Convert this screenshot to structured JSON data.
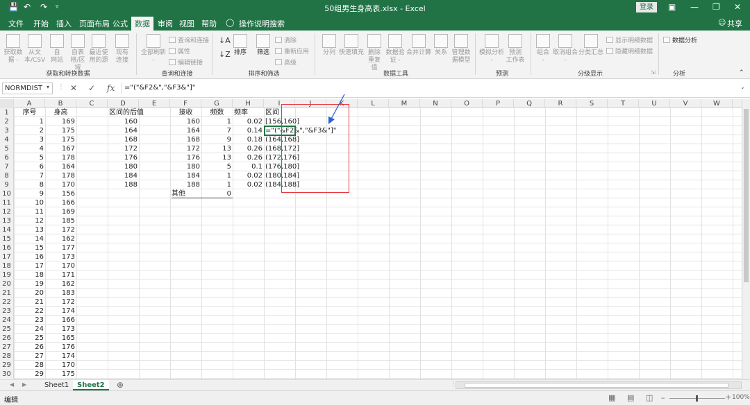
{
  "window": {
    "title": "50组男生身高表.xlsx - Excel",
    "login_label": "登录"
  },
  "menu": {
    "tabs": [
      "文件",
      "开始",
      "插入",
      "页面布局",
      "公式",
      "数据",
      "审阅",
      "视图",
      "帮助"
    ],
    "active_tab": "数据",
    "tell_me": "操作说明搜索",
    "share": "共享"
  },
  "ribbon": {
    "groups": [
      "获取和转换数据",
      "查询和连接",
      "排序和筛选",
      "数据工具",
      "预测",
      "分级显示",
      "分析"
    ],
    "get_data": {
      "btn1_l1": "获取数",
      "btn1_l2": "据 -",
      "btn2_l1": "从文",
      "btn2_l2": "本/CSV",
      "btn3_l1": "自",
      "btn3_l2": "网站",
      "btn4_l1": "自表",
      "btn4_l2": "格/区域",
      "btn5_l1": "最近使",
      "btn5_l2": "用的源",
      "btn6_l1": "现有",
      "btn6_l2": "连接"
    },
    "queries": {
      "refresh_l1": "全部刷新",
      "refresh_l2": "-",
      "q1": "查询和连接",
      "q2": "属性",
      "q3": "编辑链接"
    },
    "sort": {
      "sort": "排序",
      "filter": "筛选",
      "clear": "清除",
      "reapply": "重新应用",
      "advanced": "高级"
    },
    "tools": {
      "split": "分列",
      "flash": "快速填充",
      "dup_l1": "删除",
      "dup_l2": "重复值",
      "valid_l1": "数据验",
      "valid_l2": "证 -",
      "consol": "合并计算",
      "rel": "关系",
      "model_l1": "管理数",
      "model_l2": "据模型"
    },
    "forecast": {
      "whatif_l1": "模拟分析",
      "whatif_l2": "-",
      "sheet_l1": "预测",
      "sheet_l2": "工作表"
    },
    "outline": {
      "group_l1": "组合",
      "group_l2": "-",
      "ungroup_l1": "取消组合",
      "ungroup_l2": "-",
      "subtotal": "分类汇总",
      "show": "显示明细数据",
      "hide": "隐藏明细数据"
    },
    "analysis": {
      "data_analysis": "数据分析"
    }
  },
  "formula_bar": {
    "name_box": "NORMDIST",
    "formula": "=\"(\"&F2&\",\"&F3&\"]\""
  },
  "columns": [
    "A",
    "B",
    "C",
    "D",
    "E",
    "F",
    "G",
    "H",
    "I",
    "J",
    "K",
    "L",
    "M",
    "N",
    "O",
    "P",
    "Q",
    "R",
    "S",
    "T",
    "U",
    "V",
    "W"
  ],
  "rows": [
    "1",
    "2",
    "3",
    "4",
    "5",
    "6",
    "7",
    "8",
    "9",
    "10",
    "11",
    "12",
    "13",
    "14",
    "15",
    "16",
    "17",
    "18",
    "19",
    "20",
    "21",
    "22",
    "23",
    "24",
    "25",
    "26",
    "27",
    "28",
    "29",
    "30"
  ],
  "sheet": {
    "A1": "序号",
    "B1": "身高",
    "D1": "区间的后值",
    "F1": "接收",
    "G1": "频数",
    "H1": "频率",
    "I1": "区间",
    "A": [
      "1",
      "2",
      "3",
      "4",
      "5",
      "6",
      "7",
      "8",
      "9",
      "10",
      "11",
      "12",
      "13",
      "14",
      "15",
      "16",
      "17",
      "18",
      "19",
      "20",
      "21",
      "22",
      "23",
      "24",
      "25",
      "26",
      "27",
      "28",
      "29"
    ],
    "B": [
      "169",
      "175",
      "175",
      "167",
      "178",
      "164",
      "178",
      "170",
      "156",
      "166",
      "169",
      "185",
      "172",
      "162",
      "177",
      "173",
      "170",
      "171",
      "162",
      "183",
      "172",
      "174",
      "166",
      "173",
      "165",
      "176",
      "174",
      "170",
      "175"
    ],
    "D": [
      "160",
      "164",
      "168",
      "172",
      "176",
      "180",
      "184",
      "188"
    ],
    "F": [
      "160",
      "164",
      "168",
      "172",
      "176",
      "180",
      "184",
      "188"
    ],
    "G": [
      "1",
      "7",
      "9",
      "13",
      "13",
      "5",
      "1",
      "1"
    ],
    "H": [
      "0.02",
      "0.14",
      "0.18",
      "0.26",
      "0.26",
      "0.1",
      "0.02",
      "0.02"
    ],
    "I": [
      "[156,160]",
      "=\"(\"&F2&\",\"&F3&\"]\"",
      "(164,168]",
      "(168,172]",
      "(172,176]",
      "(176,180]",
      "(180,184]",
      "(184,188]"
    ],
    "F10": "其他",
    "G10": "0"
  },
  "sheets": {
    "tabs": [
      "Sheet1",
      "Sheet2"
    ],
    "active": "Sheet2"
  },
  "status": {
    "mode": "编辑",
    "zoom": "100%"
  },
  "colors": {
    "excel_green": "#217346",
    "annotation_red": "#e8333b",
    "arrow_blue": "#2f5fd0"
  }
}
